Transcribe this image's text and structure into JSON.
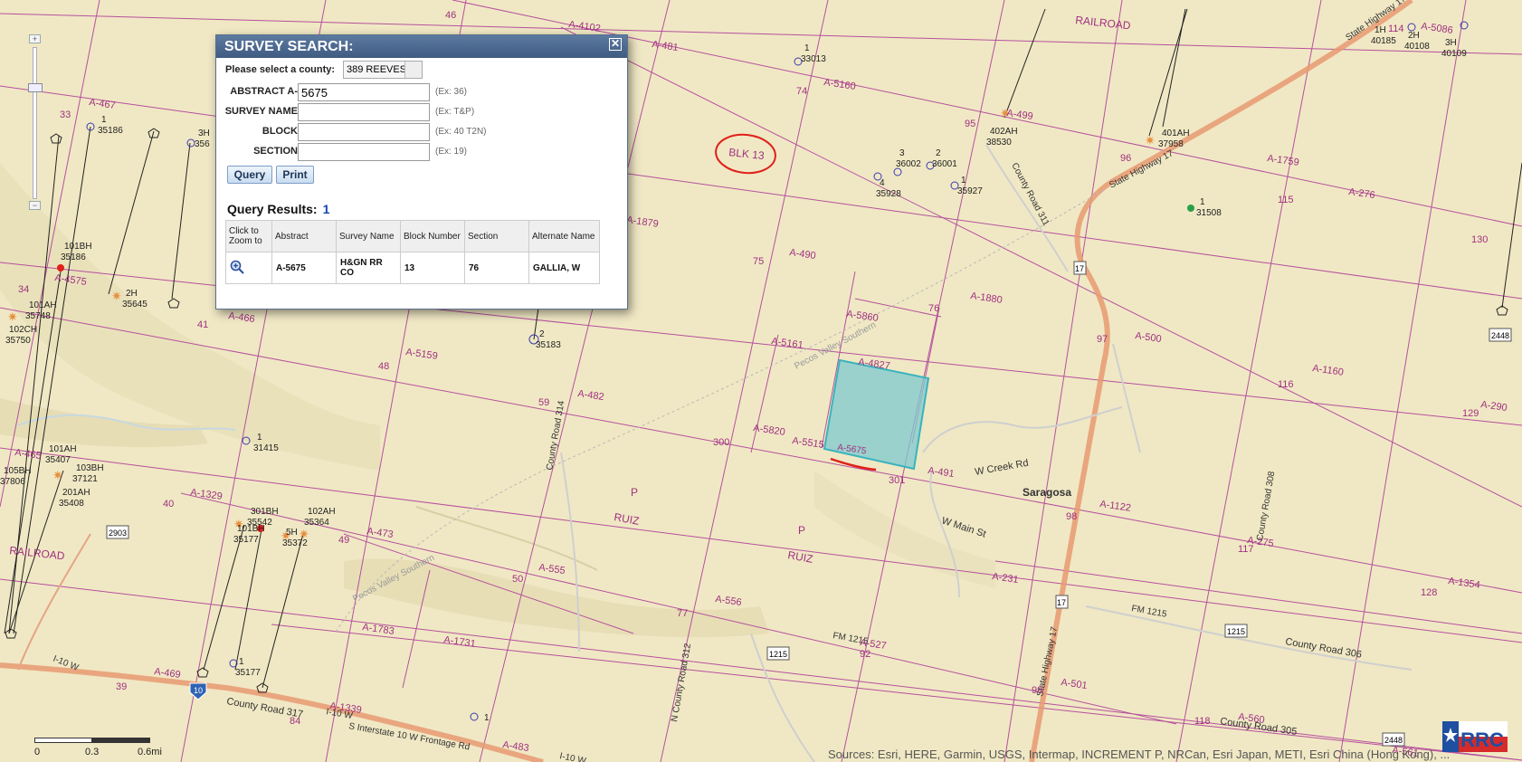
{
  "dialog": {
    "title": "SURVEY SEARCH:",
    "county_prompt": "Please select a county:",
    "county_value": "389 REEVES",
    "fields": [
      {
        "label": "ABSTRACT A-",
        "value": "5675",
        "example": "(Ex: 36)"
      },
      {
        "label": "SURVEY NAME",
        "value": "",
        "example": "(Ex: T&P)"
      },
      {
        "label": "BLOCK",
        "value": "",
        "example": "(Ex: 40 T2N)"
      },
      {
        "label": "SECTION",
        "value": "",
        "example": "(Ex: 19)"
      }
    ],
    "query_button": "Query",
    "print_button": "Print",
    "results_label": "Query Results:",
    "results_count": "1",
    "table_headers": [
      "Click to Zoom to",
      "Abstract",
      "Survey Name",
      "Block Number",
      "Section",
      "Alternate Name"
    ],
    "table_rows": [
      {
        "abstract": "A-5675",
        "survey_name": "H&GN RR CO",
        "block": "13",
        "section": "76",
        "alternate": "GALLIA, W"
      }
    ]
  },
  "map": {
    "labels": {
      "railroad_top": "RAILROAD",
      "railroad_left": "RAILROAD",
      "blk13": "BLK 13",
      "saragosa": "Saragosa",
      "ruiz_p1": "P",
      "ruiz_1": "RUIZ",
      "ruiz_p2": "P",
      "ruiz_2": "RUIZ",
      "w_creek": "W Creek Rd",
      "main_st": "W Main St",
      "cr311": "County Road 311",
      "cr314": "County Road 314",
      "cr308": "County Road 308",
      "cr306": "County Road 306",
      "cr312": "N County Road 312",
      "cr317": "County Road 317",
      "cr305": "County Road 305",
      "fm1215a": "FM 1215",
      "fm1215b": "FM 1215",
      "sh17a": "State Highway 17",
      "sh17b": "State Highway 17",
      "sh17c": "State Highway 17",
      "i10": "I-10 W",
      "i10b": "I-10 W",
      "i10c": "I-10 W",
      "frontage": "S Interstate 10 W Frontage Rd",
      "pecos1": "Pecos Valley Southern",
      "pecos2": "Pecos Valley Southern",
      "selected_abstract": "A-5675",
      "shield_17a": "17",
      "shield_17b": "17",
      "shield_1215a": "1215",
      "shield_1215b": "1215",
      "shield_2903": "2903",
      "shield_2448a": "2448",
      "shield_2448b": "2448",
      "shield_10": "10",
      "abstracts": [
        "A-4102",
        "A-481",
        "A-5160",
        "A-499",
        "A-1759",
        "A-276",
        "A-467",
        "A-1879",
        "A-490",
        "A-1880",
        "A-5860",
        "A-4827",
        "A-5161",
        "A-500",
        "A-1160",
        "A-290",
        "A-4575",
        "A-466",
        "A-5159",
        "A-482",
        "A-5820",
        "A-5515",
        "A-491",
        "A-1122",
        "A-275",
        "A-1354",
        "A-465",
        "A-1329",
        "A-473",
        "A-555",
        "A-556",
        "A-231",
        "A-1783",
        "A-1731",
        "A-527",
        "A-469",
        "A-1339",
        "A-483",
        "A-501",
        "A-560",
        "A-561",
        "A-5086"
      ],
      "sections": [
        "46",
        "74",
        "95",
        "96",
        "115",
        "130",
        "33",
        "34",
        "41",
        "75",
        "76",
        "97",
        "116",
        "129",
        "48",
        "59",
        "300",
        "301",
        "98",
        "117",
        "128",
        "40",
        "49",
        "50",
        "77",
        "92",
        "99",
        "118",
        "39",
        "84",
        "114"
      ],
      "wells": [
        {
          "id": "1",
          "num": "33013"
        },
        {
          "id": "1",
          "num": "35186"
        },
        {
          "id": "3H",
          "num": "356"
        },
        {
          "id": "3",
          "num": "36002"
        },
        {
          "id": "2",
          "num": "36001"
        },
        {
          "id": "4",
          "num": "35928"
        },
        {
          "id": "1",
          "num": "35927"
        },
        {
          "id": "402AH",
          "num": "38530"
        },
        {
          "id": "401AH",
          "num": "37958"
        },
        {
          "id": "1",
          "num": "31508"
        },
        {
          "id": "1H",
          "num": "40185"
        },
        {
          "id": "2H",
          "num": "40108"
        },
        {
          "id": "3H",
          "num": "40109"
        },
        {
          "id": "101BH",
          "num": "35186"
        },
        {
          "id": "2H",
          "num": "35645"
        },
        {
          "id": "101AH",
          "num": "35748"
        },
        {
          "id": "102CH",
          "num": "35750"
        },
        {
          "id": "2",
          "num": "35183"
        },
        {
          "id": "1",
          "num": "31415"
        },
        {
          "id": "101AH",
          "num": "35407"
        },
        {
          "id": "103BH",
          "num": "37121"
        },
        {
          "id": "105BH",
          "num": "37806"
        },
        {
          "id": "201AH",
          "num": "35408"
        },
        {
          "id": "301BH",
          "num": "35542"
        },
        {
          "id": "102AH",
          "num": "35364"
        },
        {
          "id": "101BH",
          "num": "35177"
        },
        {
          "id": "5H",
          "num": "35372"
        },
        {
          "id": "1",
          "num": "35177"
        },
        {
          "id": "1",
          "num": ""
        }
      ]
    }
  },
  "scale": {
    "ticks": [
      "0",
      "0.3",
      "0.6mi"
    ]
  },
  "attribution": "Sources: Esri, HERE, Garmin, USGS, Intermap, INCREMENT P, NRCan, Esri Japan, METI, Esri China (Hong Kong), ...",
  "logo_text": "RRC",
  "colors": {
    "map_bg": "#f0e8c4",
    "survey_line": "#b0409a",
    "selected_fill": "#7ec9cf",
    "annotation": "#e0201a",
    "dialog_header": "#4a6890"
  }
}
